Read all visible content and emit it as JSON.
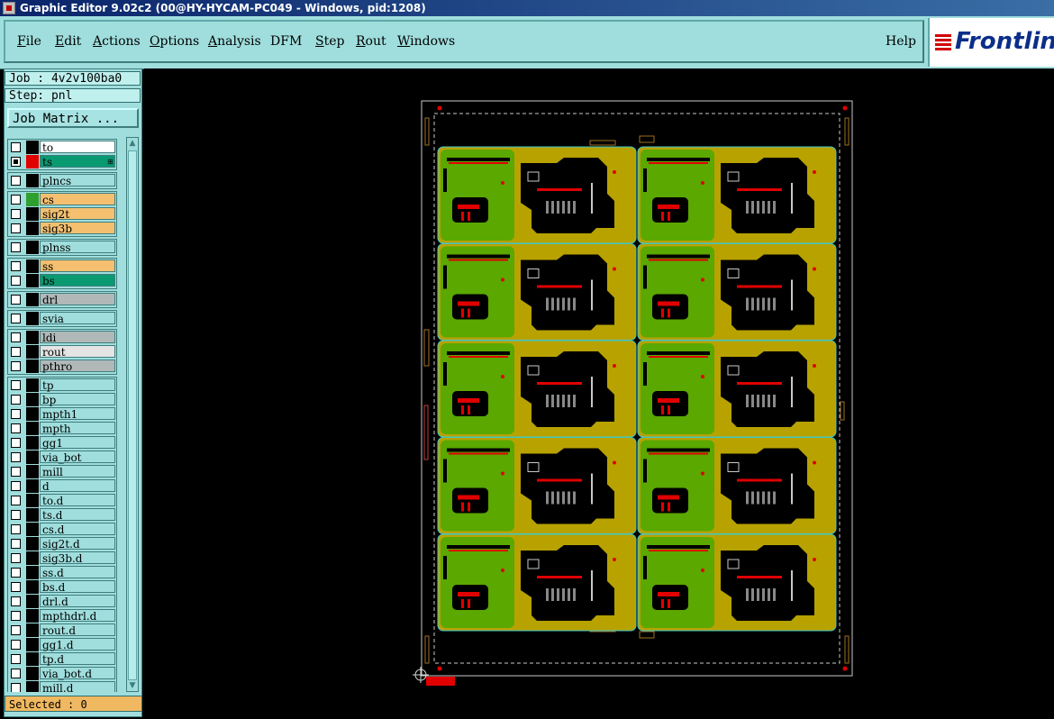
{
  "window": {
    "title": "Graphic Editor 9.02c2 (00@HY-HYCAM-PC049 - Windows, pid:1208)"
  },
  "menu": {
    "items": [
      {
        "label": "File",
        "mnemonic": "F",
        "rest": "ile"
      },
      {
        "label": "Edit",
        "mnemonic": "E",
        "rest": "dit"
      },
      {
        "label": "Actions",
        "mnemonic": "A",
        "rest": "ctions"
      },
      {
        "label": "Options",
        "mnemonic": "O",
        "rest": "ptions"
      },
      {
        "label": "Analysis",
        "mnemonic": "A",
        "rest": "nalysis"
      },
      {
        "label": "DFM",
        "mnemonic": "",
        "rest": "DFM"
      },
      {
        "label": "Step",
        "mnemonic": "S",
        "rest": "tep"
      },
      {
        "label": "Rout",
        "mnemonic": "R",
        "rest": "out"
      },
      {
        "label": "Windows",
        "mnemonic": "W",
        "rest": "indows"
      }
    ],
    "help": "Help"
  },
  "logo": {
    "text": "Frontlin"
  },
  "job": {
    "label": "Job : 4v2v100ba0"
  },
  "step": {
    "label": "Step: pnl"
  },
  "job_matrix": {
    "label": "Job Matrix ..."
  },
  "layers": [
    {
      "name": "to",
      "color": "#ffffff",
      "swatch": "#000000",
      "checked": false
    },
    {
      "name": "ts",
      "color": "#0a9a72",
      "swatch": "#e00000",
      "checked": true,
      "fixed": true
    },
    {
      "name": "plncs",
      "color": "#9fdedd",
      "swatch": "#000000",
      "checked": false
    },
    {
      "name": "cs",
      "color": "#f4c070",
      "swatch": "#2f9f2f",
      "checked": false
    },
    {
      "name": "sig2t",
      "color": "#f4c070",
      "swatch": "#000000",
      "checked": false
    },
    {
      "name": "sig3b",
      "color": "#f4c070",
      "swatch": "#000000",
      "checked": false
    },
    {
      "name": "plnss",
      "color": "#9fdedd",
      "swatch": "#000000",
      "checked": false
    },
    {
      "name": "ss",
      "color": "#f4c070",
      "swatch": "#000000",
      "checked": false
    },
    {
      "name": "bs",
      "color": "#0a9a72",
      "swatch": "#000000",
      "checked": false
    },
    {
      "name": "drl",
      "color": "#b0b8b8",
      "swatch": "#000000",
      "checked": false
    },
    {
      "name": "svia",
      "color": "#9fdedd",
      "swatch": "#000000",
      "checked": false
    },
    {
      "name": "ldi",
      "color": "#b0b8b8",
      "swatch": "#000000",
      "checked": false
    },
    {
      "name": "rout",
      "color": "#e4e4e4",
      "swatch": "#000000",
      "checked": false
    },
    {
      "name": "pthro",
      "color": "#b0b8b8",
      "swatch": "#000000",
      "checked": false
    },
    {
      "name": "tp",
      "color": "#9fdedd",
      "swatch": "#000000",
      "checked": false
    },
    {
      "name": "bp",
      "color": "#9fdedd",
      "swatch": "#000000",
      "checked": false
    },
    {
      "name": "mpth1",
      "color": "#9fdedd",
      "swatch": "#000000",
      "checked": false
    },
    {
      "name": "mpth",
      "color": "#9fdedd",
      "swatch": "#000000",
      "checked": false
    },
    {
      "name": "gg1",
      "color": "#9fdedd",
      "swatch": "#000000",
      "checked": false
    },
    {
      "name": "via_bot",
      "color": "#9fdedd",
      "swatch": "#000000",
      "checked": false
    },
    {
      "name": "mill",
      "color": "#9fdedd",
      "swatch": "#000000",
      "checked": false
    },
    {
      "name": "d",
      "color": "#9fdedd",
      "swatch": "#000000",
      "checked": false
    },
    {
      "name": "to.d",
      "color": "#9fdedd",
      "swatch": "#000000",
      "checked": false
    },
    {
      "name": "ts.d",
      "color": "#9fdedd",
      "swatch": "#000000",
      "checked": false
    },
    {
      "name": "cs.d",
      "color": "#9fdedd",
      "swatch": "#000000",
      "checked": false
    },
    {
      "name": "sig2t.d",
      "color": "#9fdedd",
      "swatch": "#000000",
      "checked": false
    },
    {
      "name": "sig3b.d",
      "color": "#9fdedd",
      "swatch": "#000000",
      "checked": false
    },
    {
      "name": "ss.d",
      "color": "#9fdedd",
      "swatch": "#000000",
      "checked": false
    },
    {
      "name": "bs.d",
      "color": "#9fdedd",
      "swatch": "#000000",
      "checked": false
    },
    {
      "name": "drl.d",
      "color": "#9fdedd",
      "swatch": "#000000",
      "checked": false
    },
    {
      "name": "mpthdrl.d",
      "color": "#9fdedd",
      "swatch": "#000000",
      "checked": false
    },
    {
      "name": "rout.d",
      "color": "#9fdedd",
      "swatch": "#000000",
      "checked": false
    },
    {
      "name": "gg1.d",
      "color": "#9fdedd",
      "swatch": "#000000",
      "checked": false
    },
    {
      "name": "tp.d",
      "color": "#9fdedd",
      "swatch": "#000000",
      "checked": false
    },
    {
      "name": "via_bot.d",
      "color": "#9fdedd",
      "swatch": "#000000",
      "checked": false
    },
    {
      "name": "mill.d",
      "color": "#9fdedd",
      "swatch": "#000000",
      "checked": false
    }
  ],
  "selected": {
    "label": "Selected : 0"
  },
  "colors": {
    "panel_bg": "#9fdedd",
    "board_yellow": "#b8a200",
    "board_green": "#5aa800",
    "copper_black": "#000000",
    "pad_red": "#e00000",
    "outline_cyan": "#40c8c8"
  },
  "panel": {
    "rows": 5,
    "cols": 2
  }
}
